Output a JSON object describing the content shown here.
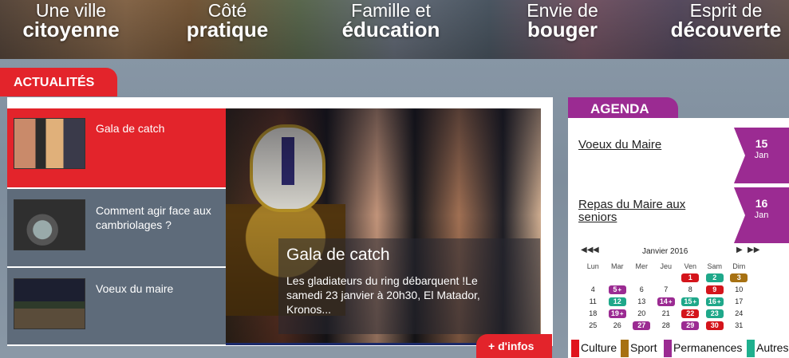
{
  "nav": [
    {
      "line1": "Une ville",
      "line2": "citoyenne"
    },
    {
      "line1": "Côté",
      "line2": "pratique"
    },
    {
      "line1": "Famille et",
      "line2": "éducation"
    },
    {
      "line1": "Envie de",
      "line2": "bouger"
    },
    {
      "line1": "Esprit de",
      "line2": "découverte"
    }
  ],
  "actus": {
    "tab_label": "ACTUALITÉS",
    "items": [
      {
        "title": "Gala de catch"
      },
      {
        "title": "Comment agir face aux cambriolages ?"
      },
      {
        "title": "Voeux du maire"
      }
    ],
    "hero": {
      "title": "Gala de catch",
      "text": "Les gladiateurs du ring débarquent !Le samedi 23 janvier à 20h30, El Matador, Kronos..."
    },
    "more_label": "+ d'infos"
  },
  "agenda": {
    "tab_label": "AGENDA",
    "events": [
      {
        "title": "Voeux du Maire",
        "day": "15",
        "month": "Jan"
      },
      {
        "title": "Repas du Maire aux seniors",
        "day": "16",
        "month": "Jan"
      }
    ],
    "calendar": {
      "title": "Janvier 2016",
      "prev_year": "◀◀",
      "prev_month": "◀",
      "next_month": "▶",
      "next_year": "▶▶",
      "weekdays": [
        "Lun",
        "Mar",
        "Mer",
        "Jeu",
        "Ven",
        "Sam",
        "Dim"
      ],
      "weeks": [
        [
          null,
          null,
          null,
          null,
          {
            "d": "1",
            "c": "#d4141b"
          },
          {
            "d": "2",
            "c": "#1fa88a"
          },
          {
            "d": "3",
            "c": "#a77112"
          }
        ],
        [
          {
            "d": "4"
          },
          {
            "d": "5",
            "c": "#9b2b92",
            "more": true
          },
          {
            "d": "6"
          },
          {
            "d": "7"
          },
          {
            "d": "8"
          },
          {
            "d": "9",
            "c": "#d4141b"
          },
          {
            "d": "10"
          }
        ],
        [
          {
            "d": "11"
          },
          {
            "d": "12",
            "c": "#1fa88a"
          },
          {
            "d": "13"
          },
          {
            "d": "14",
            "c": "#9b2b92",
            "more": true
          },
          {
            "d": "15",
            "c": "#1fa88a",
            "more": true
          },
          {
            "d": "16",
            "c": "#1fa88a",
            "more": true
          },
          {
            "d": "17"
          }
        ],
        [
          {
            "d": "18"
          },
          {
            "d": "19",
            "c": "#9b2b92",
            "more": true
          },
          {
            "d": "20"
          },
          {
            "d": "21"
          },
          {
            "d": "22",
            "c": "#d4141b"
          },
          {
            "d": "23",
            "c": "#1fa88a"
          },
          {
            "d": "24"
          }
        ],
        [
          {
            "d": "25"
          },
          {
            "d": "26"
          },
          {
            "d": "27",
            "c": "#9b2b92"
          },
          {
            "d": "28"
          },
          {
            "d": "29",
            "c": "#9b2b92"
          },
          {
            "d": "30",
            "c": "#d4141b"
          },
          {
            "d": "31"
          }
        ]
      ]
    },
    "legend": [
      {
        "label": "Culture",
        "color": "#e0141c"
      },
      {
        "label": "Sport",
        "color": "#a77112"
      },
      {
        "label": "Permanences",
        "color": "#9b2b92"
      },
      {
        "label": "Autres",
        "color": "#1fb08e"
      }
    ]
  },
  "colors": {
    "accent_red": "#e3242b",
    "agenda_purple": "#9b2b92"
  }
}
